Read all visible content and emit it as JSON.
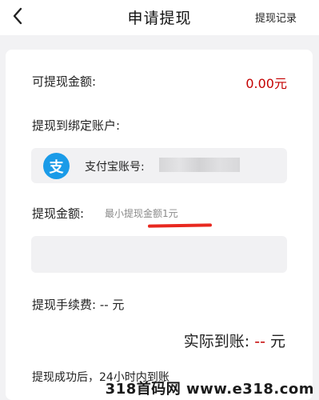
{
  "header": {
    "title": "申请提现",
    "history_label": "提现记录"
  },
  "balance": {
    "label": "可提现金额:",
    "value": "0.00元"
  },
  "account": {
    "bind_label": "提现到绑定账户:",
    "type_label": "支付宝账号:",
    "icon_glyph": "支"
  },
  "withdraw": {
    "label": "提现金额:",
    "min_hint": "最小提现金额1元",
    "input_value": ""
  },
  "fee": {
    "text": "提现手续费: -- 元"
  },
  "actual": {
    "label": "实际到账:",
    "value": "--",
    "unit": "元"
  },
  "notice": "提现成功后，24小时内到账",
  "watermark": "318首码网 www.e318.com",
  "colors": {
    "accent_red": "#c40000",
    "alipay_blue": "#1a9be8"
  }
}
